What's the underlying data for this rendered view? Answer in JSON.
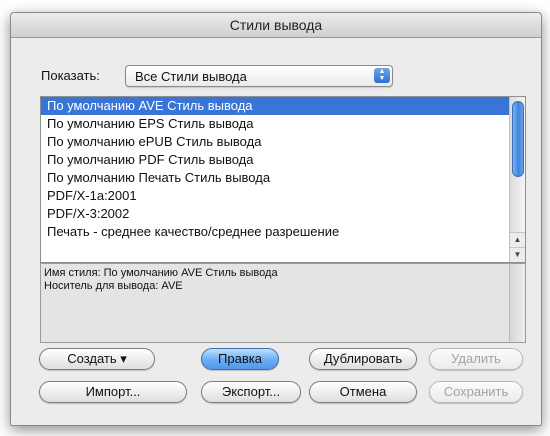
{
  "dialog": {
    "title": "Стили вывода"
  },
  "show": {
    "label": "Показать:",
    "value": "Все Стили вывода",
    "arrows_icon": "popup-arrows-icon"
  },
  "styles": {
    "items": [
      "По умолчанию AVE Стиль вывода",
      "По умолчанию EPS Стиль вывода",
      "По умолчанию ePUB Стиль вывода",
      "По умолчанию PDF Стиль вывода",
      "По умолчанию Печать Стиль вывода",
      "PDF/X-1a:2001",
      "PDF/X-3:2002",
      "Печать - среднее качество/среднее разрешение"
    ],
    "selected_index": 0
  },
  "info": {
    "line1": "Имя стиля: По умолчанию AVE Стиль вывода",
    "line2": "Носитель для вывода: AVE"
  },
  "buttons": {
    "create": "Создать ▾",
    "edit": "Правка",
    "duplicate": "Дублировать",
    "delete": "Удалить",
    "import": "Импорт...",
    "export": "Экспорт...",
    "cancel": "Отмена",
    "save": "Сохранить"
  },
  "colors": {
    "selection": "#3875d7",
    "default_button": "#6fb0f4",
    "disabled_text": "#a2a2a2"
  }
}
